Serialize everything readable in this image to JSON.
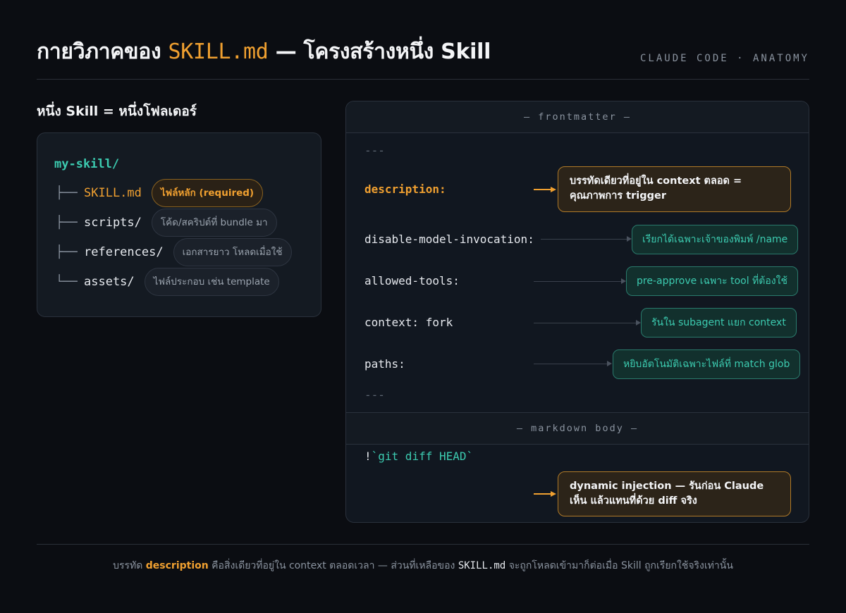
{
  "header": {
    "title_prefix": "กายวิภาคของ ",
    "title_accent": "SKILL.md",
    "title_suffix": " — โครงสร้างหนึ่ง Skill",
    "kicker": "CLAUDE CODE · ANATOMY"
  },
  "left": {
    "heading": "หนึ่ง Skill = หนึ่งโฟลเดอร์",
    "root": "my-skill/",
    "items": [
      {
        "branch": "├──",
        "name": "SKILL.md",
        "tag": "ไฟล์หลัก (required)"
      },
      {
        "branch": "├──",
        "name": "scripts/",
        "tag": "โค้ด/สคริปต์ที่ bundle มา"
      },
      {
        "branch": "├──",
        "name": "references/",
        "tag": "เอกสารยาว โหลดเมื่อใช้"
      },
      {
        "branch": "└──",
        "name": "assets/",
        "tag": "ไฟล์ประกอบ เช่น template"
      }
    ]
  },
  "right": {
    "frontmatter_label": "— frontmatter —",
    "dashes": "---",
    "fields": [
      {
        "key": "description:",
        "note": "บรรทัดเดียวที่อยู่ใน context ตลอด = คุณภาพการ trigger"
      },
      {
        "key": "disable-model-invocation:",
        "note": "เรียกได้เฉพาะเจ้าของพิมพ์ /name"
      },
      {
        "key": "allowed-tools:",
        "note": "pre-approve เฉพาะ tool ที่ต้องใช้"
      },
      {
        "key": "context: fork",
        "note": "รันใน subagent แยก context"
      },
      {
        "key": "paths:",
        "note": "หยิบอัตโนมัติเฉพาะไฟล์ที่ match glob"
      }
    ],
    "body_label": "— markdown body —",
    "body_bang": "!",
    "body_code": "`git diff HEAD`",
    "body_note": "dynamic injection — รันก่อน Claude เห็น แล้วแทนที่ด้วย diff จริง"
  },
  "footer": {
    "pre": "บรรทัด ",
    "highlight": "description",
    "mid": " คือสิ่งเดียวที่อยู่ใน context ตลอดเวลา — ส่วนที่เหลือของ ",
    "code": "SKILL.md",
    "post": " จะถูกโหลดเข้ามาก็ต่อเมื่อ Skill ถูกเรียกใช้จริงเท่านั้น"
  }
}
